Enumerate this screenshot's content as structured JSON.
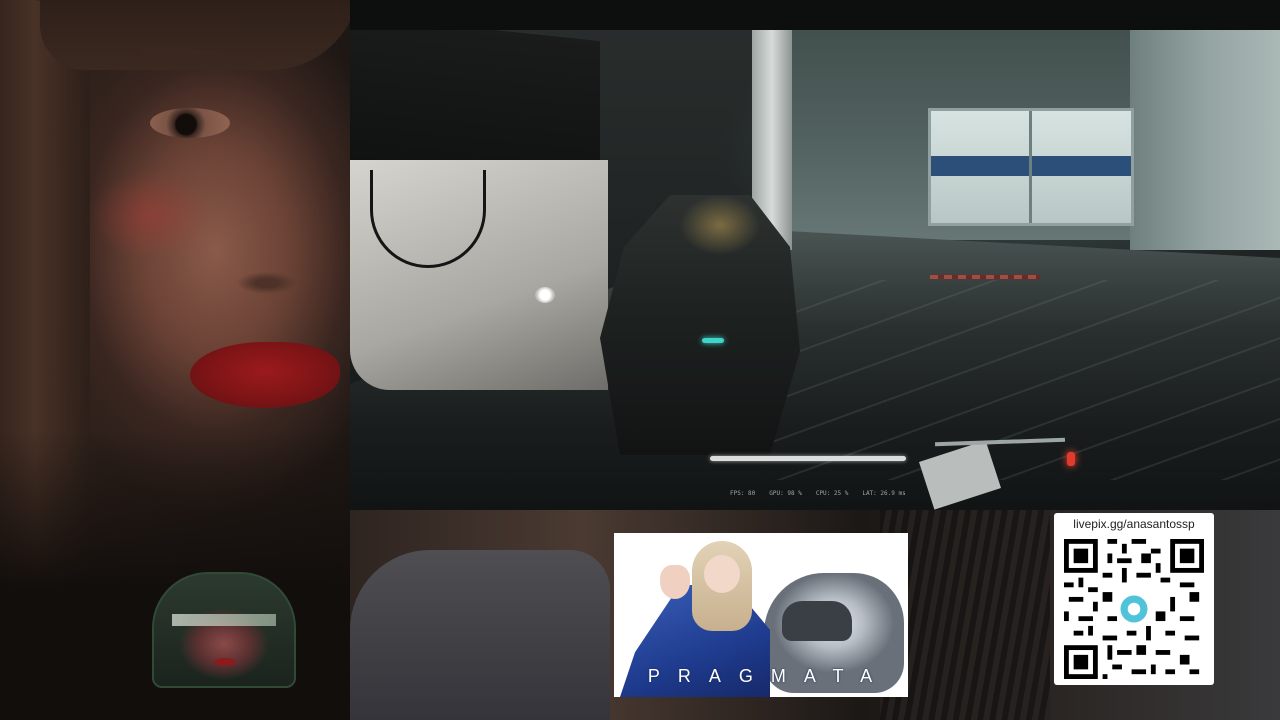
{
  "stream": {
    "donation_url": "livepix.gg/anasantossp",
    "game_title_card": "PRAGMATA",
    "perf_overlay": [
      "FPS: 80",
      "GPU: 98 %",
      "CPU: 25 %",
      "LAT: 26.9 ms"
    ]
  },
  "icons": {
    "qr": "qr-code-icon",
    "center_logo": "livepix-logo-icon"
  },
  "colors": {
    "accent_red": "#e23a2c",
    "lips": "#9b1a1c",
    "door_stripe": "#2b4f78"
  }
}
